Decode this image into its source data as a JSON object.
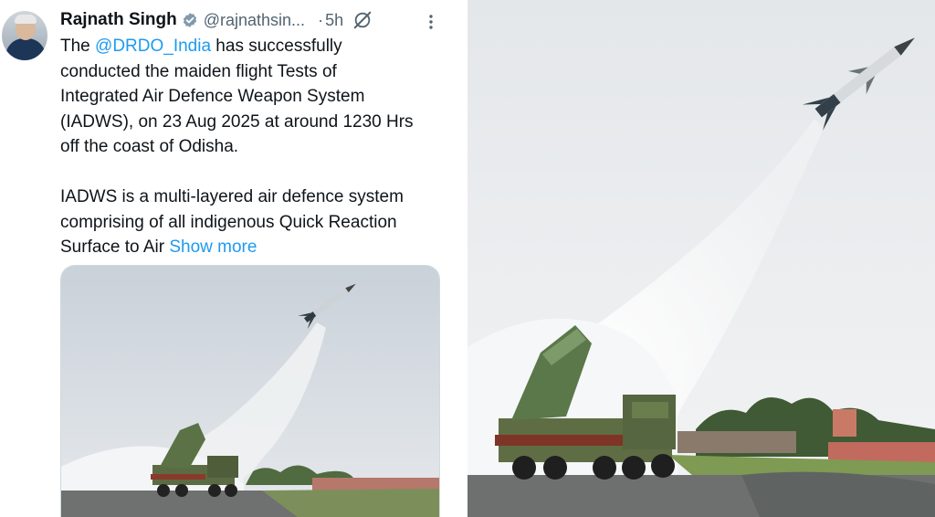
{
  "tweet": {
    "author_name": "Rajnath Singh",
    "handle": "@rajnathsin...",
    "separator": "·",
    "time": "5h",
    "text_intro": "The ",
    "mention": "@DRDO_India",
    "text_line1_rest": " has successfully",
    "text_line2": "conducted the maiden flight Tests of",
    "text_line3": "Integrated Air Defence Weapon System",
    "text_line4": "(IADWS), on 23 Aug 2025 at around 1230 Hrs",
    "text_line5": "off the coast of Odisha.",
    "text_line6": "IADWS is a multi-layered air defence system",
    "text_line7": "comprising of all indigenous Quick Reaction",
    "text_line8_prefix": "Surface to Air ",
    "show_more": "Show more"
  },
  "icons": {
    "verified": "verified-badge-icon",
    "grok": "grok-icon",
    "more": "more-options-icon"
  },
  "colors": {
    "link": "#1d9bf0",
    "secondary_text": "#536471",
    "primary_text": "#0f1419",
    "verified_badge": "#829aab"
  }
}
